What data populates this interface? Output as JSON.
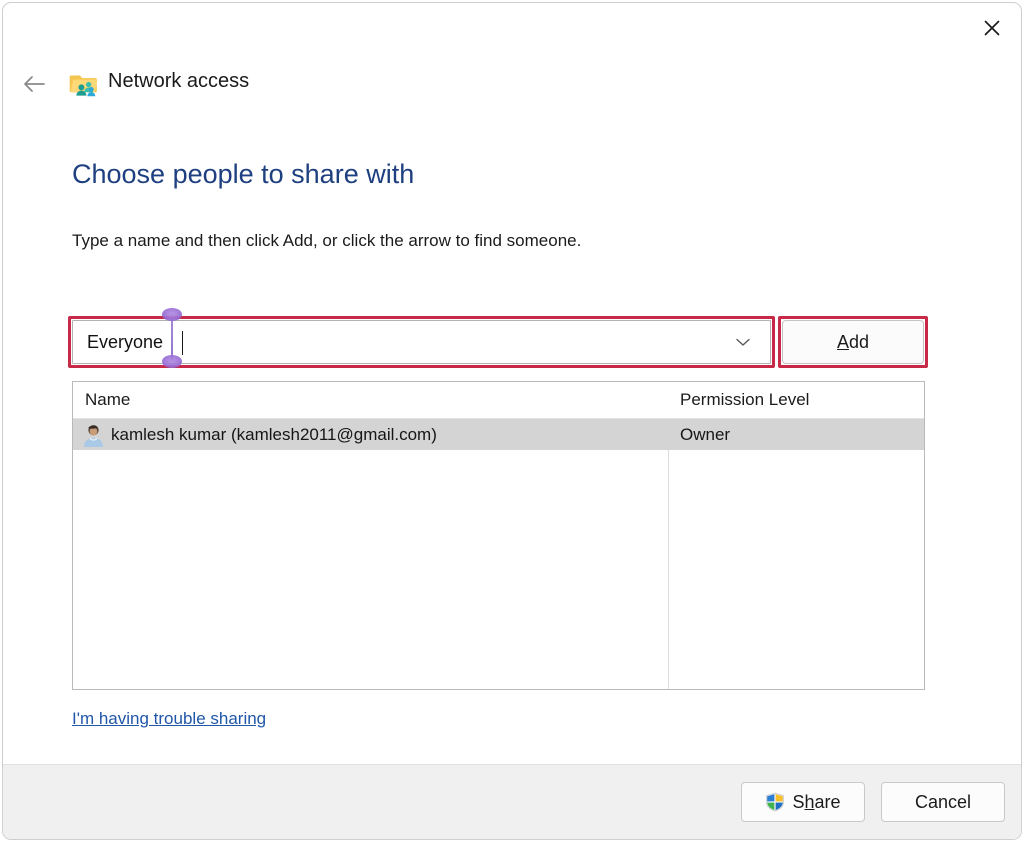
{
  "window": {
    "app_title": "Network access",
    "app_icon": "folder-share-icon",
    "back_icon": "back-arrow-icon",
    "close_icon": "close-icon"
  },
  "content": {
    "heading": "Choose people to share with",
    "subtitle": "Type a name and then click Add, or click the arrow to find someone."
  },
  "combo": {
    "value": "Everyone",
    "placeholder": "",
    "dropdown_icon": "chevron-down-icon"
  },
  "add_button": {
    "accel": "A",
    "rest": "dd",
    "full_label": "Add"
  },
  "list": {
    "columns": [
      "Name",
      "Permission Level"
    ],
    "rows": [
      {
        "avatar": "user-avatar-icon",
        "name": "kamlesh kumar (kamlesh2011@gmail.com)",
        "permission": "Owner",
        "selected": true
      }
    ]
  },
  "links": {
    "trouble": "I'm having trouble sharing"
  },
  "footer": {
    "share": {
      "accel_before": "S",
      "accel": "h",
      "accel_after": "are",
      "full_label": "Share",
      "icon": "uac-shield-icon"
    },
    "cancel": {
      "full_label": "Cancel"
    }
  },
  "annotations": {
    "highlight_color": "#c72a46",
    "handle_color": "#8a62cc",
    "targets": [
      "combo-input-highlight",
      "add-button-highlight"
    ]
  },
  "colors": {
    "heading": "#1e3f80",
    "link": "#2056a8",
    "footer_bg": "#f0f0f0",
    "row_selected": "#d4d4d4"
  }
}
